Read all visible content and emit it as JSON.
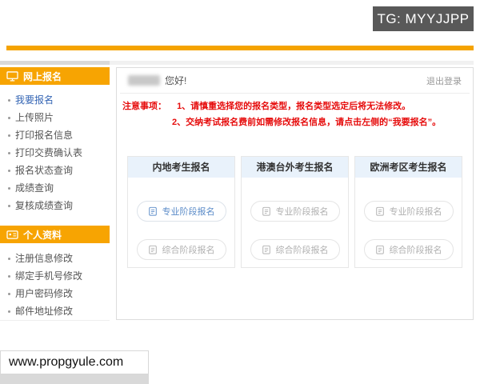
{
  "top_watermark": {
    "label": "TG: MYYJJPP"
  },
  "sidebar": {
    "sections": [
      {
        "title": "网上报名",
        "icon": "monitor-icon",
        "items": [
          {
            "label": "我要报名",
            "active": true
          },
          {
            "label": "上传照片",
            "active": false
          },
          {
            "label": "打印报名信息",
            "active": false
          },
          {
            "label": "打印交费确认表",
            "active": false
          },
          {
            "label": "报名状态查询",
            "active": false
          },
          {
            "label": "成绩查询",
            "active": false
          },
          {
            "label": "复核成绩查询",
            "active": false
          }
        ]
      },
      {
        "title": "个人资料",
        "icon": "id-card-icon",
        "items": [
          {
            "label": "注册信息修改",
            "active": false
          },
          {
            "label": "绑定手机号修改",
            "active": false
          },
          {
            "label": "用户密码修改",
            "active": false
          },
          {
            "label": "邮件地址修改",
            "active": false
          }
        ]
      }
    ]
  },
  "main": {
    "greeting_suffix": "您好!",
    "logout_label": "退出登录",
    "notice_label": "注意事项：",
    "notice_items": [
      "1、请慎重选择您的报名类型，报名类型选定后将无法修改。",
      "2、交纳考试报名费前如需修改报名信息，请点击左侧的“我要报名”。"
    ],
    "cards": [
      {
        "title": "内地考生报名",
        "buttons": [
          {
            "label": "专业阶段报名",
            "style": "primary"
          },
          {
            "label": "综合阶段报名",
            "style": "default"
          }
        ]
      },
      {
        "title": "港澳台外考生报名",
        "buttons": [
          {
            "label": "专业阶段报名",
            "style": "default"
          },
          {
            "label": "综合阶段报名",
            "style": "default"
          }
        ]
      },
      {
        "title": "欧洲考区考生报名",
        "buttons": [
          {
            "label": "专业阶段报名",
            "style": "default"
          },
          {
            "label": "综合阶段报名",
            "style": "default"
          }
        ]
      }
    ]
  },
  "bottom_watermark": {
    "label": "www.propgyule.com"
  },
  "colors": {
    "accent_orange": "#F7A402",
    "divider_orange": "#F5A300",
    "active_link_blue": "#3465B4",
    "notice_red": "#E60C0C",
    "card_header_bg": "#E9F2FB",
    "primary_button_blue": "#5A8BC8",
    "watermark_gray": "#595959"
  }
}
